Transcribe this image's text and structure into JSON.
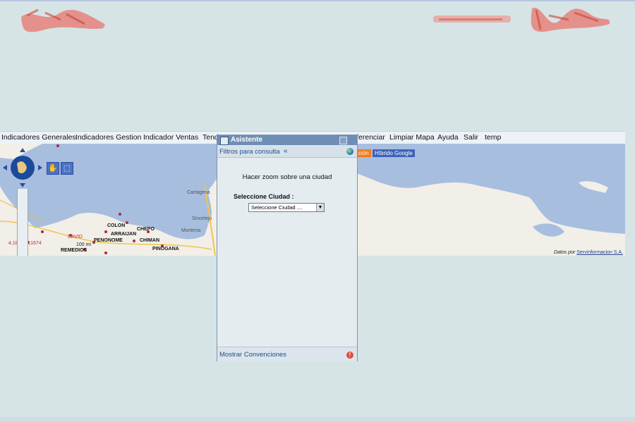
{
  "header": {
    "logo_left_name": "logo-left",
    "logo_right_name": "logo-right"
  },
  "menu": {
    "items": [
      "Indicadores Generales",
      "Indicadores Gestion",
      "Indicador Ventas",
      "Tend",
      "ferenciar",
      "Limpiar Mapa",
      "Ayuda",
      "Salir",
      "temp"
    ]
  },
  "map": {
    "buttons": [
      "ción",
      "Híbrido Google"
    ],
    "cities": [
      "COLON",
      "CHEPO",
      "ARRAIJAN",
      "PENONOME",
      "CHIMAN",
      "PINOGANA",
      "REMEDIOS",
      "Cartagena",
      "Sincelejo",
      "Monteria"
    ],
    "scale_label": "100 mi",
    "scale_top": "DAVID",
    "coords": "4,18 , 7.8,1674",
    "credit_prefix": "Datos por",
    "credit_link": "Servinformacion S.A."
  },
  "dialog": {
    "title": "Asistente",
    "section_label": "Filtros para consulta",
    "collapse": "«",
    "heading": "Hacer zoom sobre una ciudad",
    "city_label": "Seleccione Ciudad :",
    "select_value": "Seleccione Ciudad ....",
    "footer_label": "Mostrar Convenciones",
    "footer_icon": "!"
  },
  "colors": {
    "background": "#d6e4e6",
    "water": "#a8bedf",
    "land": "#f1efe8",
    "title_bar": "#6f8eb6",
    "link": "#1e4f8a",
    "orange_btn": "#f07a1a",
    "blue_btn": "#3d63b7"
  }
}
